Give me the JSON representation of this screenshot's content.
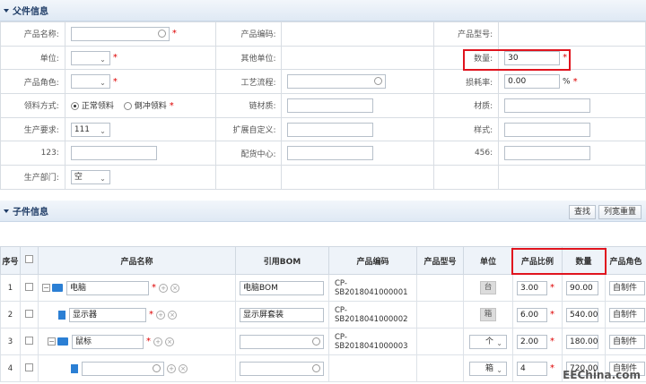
{
  "parent_section": {
    "title": "父件信息"
  },
  "form": {
    "row1": {
      "l1": "产品名称:",
      "l2": "产品编码:",
      "l3": "产品型号:"
    },
    "row2": {
      "l1": "单位:",
      "l2": "其他单位:",
      "l3": "数量:",
      "qty": "30"
    },
    "row3": {
      "l1": "产品角色:",
      "l2": "工艺流程:",
      "l3": "损耗率:",
      "loss": "0.00",
      "pct": "%"
    },
    "row4": {
      "l1": "领料方式:",
      "r1": "正常领料",
      "r2": "倒冲领料",
      "l2": "链材质:",
      "l3": "材质:"
    },
    "row5": {
      "l1": "生产要求:",
      "req": "111",
      "l2": "扩展自定义:",
      "l3": "样式:"
    },
    "row6": {
      "l1": "123:",
      "l2": "配货中心:",
      "l3": "456:"
    },
    "row7": {
      "l1": "生产部门:",
      "dept": "空"
    }
  },
  "child_section": {
    "title": "子件信息",
    "btn_search": "查找",
    "btn_reset": "列宽重置"
  },
  "grid": {
    "headers": [
      "序号",
      "",
      "产品名称",
      "引用BOM",
      "产品编码",
      "产品型号",
      "单位",
      "产品比例",
      "数量",
      "产品角色"
    ],
    "rows": [
      {
        "no": "1",
        "name": "电脑",
        "bom": "电脑BOM",
        "code": "CP-SB2018041000001",
        "unit": "台",
        "ratio": "3.00",
        "qty": "90.00",
        "role": "自制件"
      },
      {
        "no": "2",
        "name": "显示器",
        "bom": "显示屏套装",
        "code": "CP-SB2018041000002",
        "unit": "箱",
        "ratio": "6.00",
        "qty": "540.00",
        "role": "自制件"
      },
      {
        "no": "3",
        "name": "鼠标",
        "bom": "",
        "code": "CP-SB2018041000003",
        "unit": "个",
        "ratio": "2.00",
        "qty": "180.00",
        "role": "自制件"
      },
      {
        "no": "4",
        "name": "",
        "bom": "",
        "code": "",
        "unit": "箱",
        "ratio": "4",
        "qty": "720.00",
        "role": "自制件"
      }
    ]
  },
  "watermark": "EEChina.com"
}
